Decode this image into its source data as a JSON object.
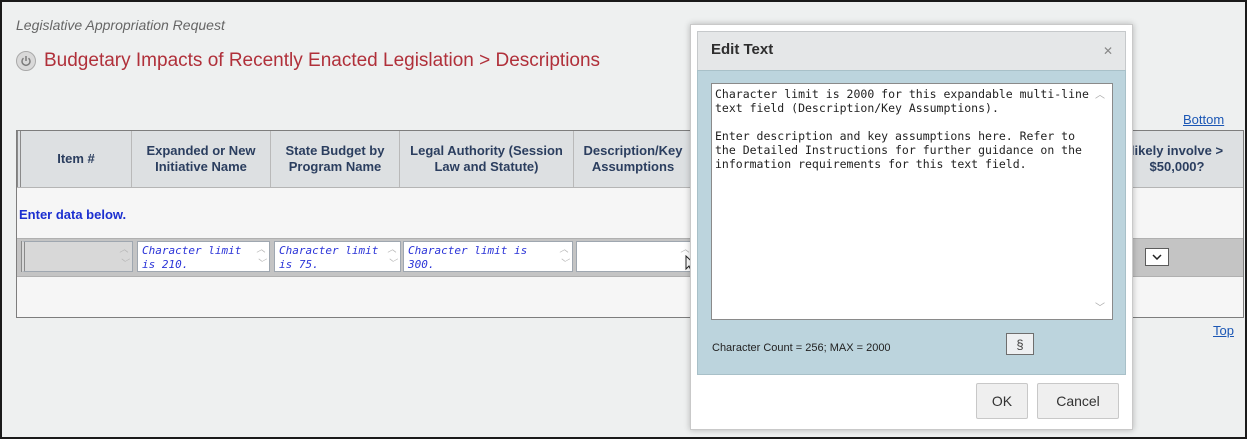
{
  "header": {
    "app_subtitle": "Legislative Appropriation Request",
    "page_title": "Budgetary Impacts of Recently Enacted Legislation > Descriptions"
  },
  "links": {
    "bottom": "Bottom",
    "top": "Top"
  },
  "table": {
    "columns": [
      "Item #",
      "Expanded or New Initiative Name",
      "State Budget by Program Name",
      "Legal Authority (Session Law and Statute)",
      "Description/Key Assumptions",
      "likely involve > $50,000?"
    ],
    "enter_label": "Enter data below.",
    "row_cells": [
      "",
      "Character limit is 210.",
      "Character limit is 75.",
      "Character limit is 300.",
      ""
    ]
  },
  "dialog": {
    "title": "Edit Text",
    "text": "Character limit is 2000 for this expandable multi-line text field (Description/Key Assumptions).\n\nEnter description and key assumptions here. Refer to the Detailed Instructions for further guidance on the information requirements for this text field.",
    "char_count": "Character Count = 256; MAX = 2000",
    "section_symbol": "§",
    "ok_label": "OK",
    "cancel_label": "Cancel",
    "close_symbol": "✕"
  },
  "icons": [
    "power-icon",
    "close-icon",
    "chevron-down-icon",
    "cursor-icon"
  ]
}
